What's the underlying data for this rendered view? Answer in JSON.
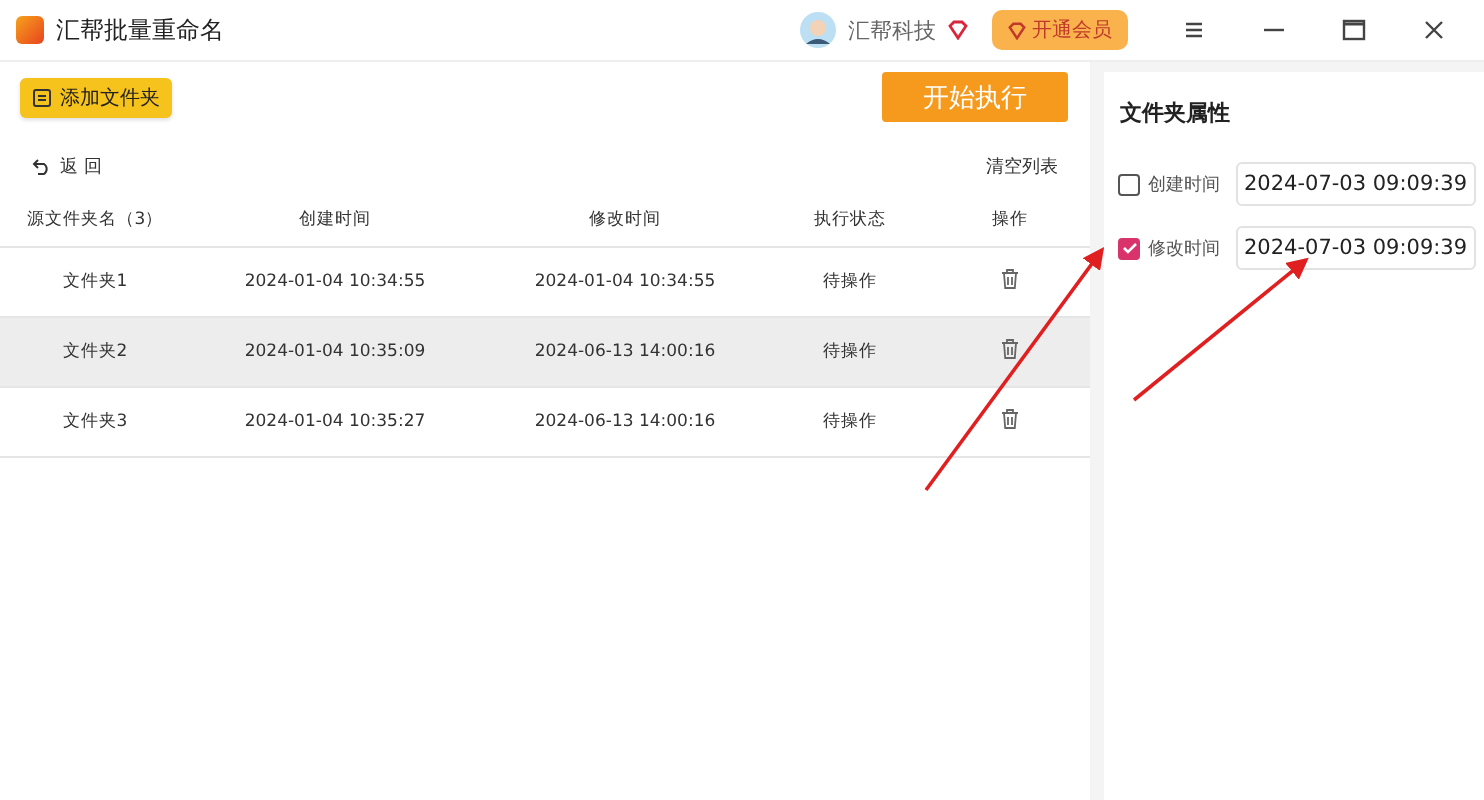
{
  "window": {
    "title": "汇帮批量重命名",
    "user": "汇帮科技",
    "vip_button": "开通会员"
  },
  "toolbar": {
    "add_button": "添加文件夹",
    "start_button": "开始执行",
    "back_link": "返 回",
    "clear_link": "清空列表"
  },
  "table": {
    "columns": [
      "源文件夹名（3）",
      "创建时间",
      "修改时间",
      "执行状态",
      "操作"
    ],
    "rows": [
      {
        "name": "文件夹1",
        "created": "2024-01-04 10:34:55",
        "modified": "2024-01-04 10:34:55",
        "status": "待操作",
        "selected": false
      },
      {
        "name": "文件夹2",
        "created": "2024-01-04 10:35:09",
        "modified": "2024-06-13 14:00:16",
        "status": "待操作",
        "selected": true
      },
      {
        "name": "文件夹3",
        "created": "2024-01-04 10:35:27",
        "modified": "2024-06-13 14:00:16",
        "status": "待操作",
        "selected": false
      }
    ]
  },
  "panel": {
    "title": "文件夹属性",
    "options": [
      {
        "label": "创建时间",
        "checked": false,
        "value": "2024-07-03 09:09:39"
      },
      {
        "label": "修改时间",
        "checked": true,
        "value": "2024-07-03 09:09:39"
      }
    ]
  }
}
